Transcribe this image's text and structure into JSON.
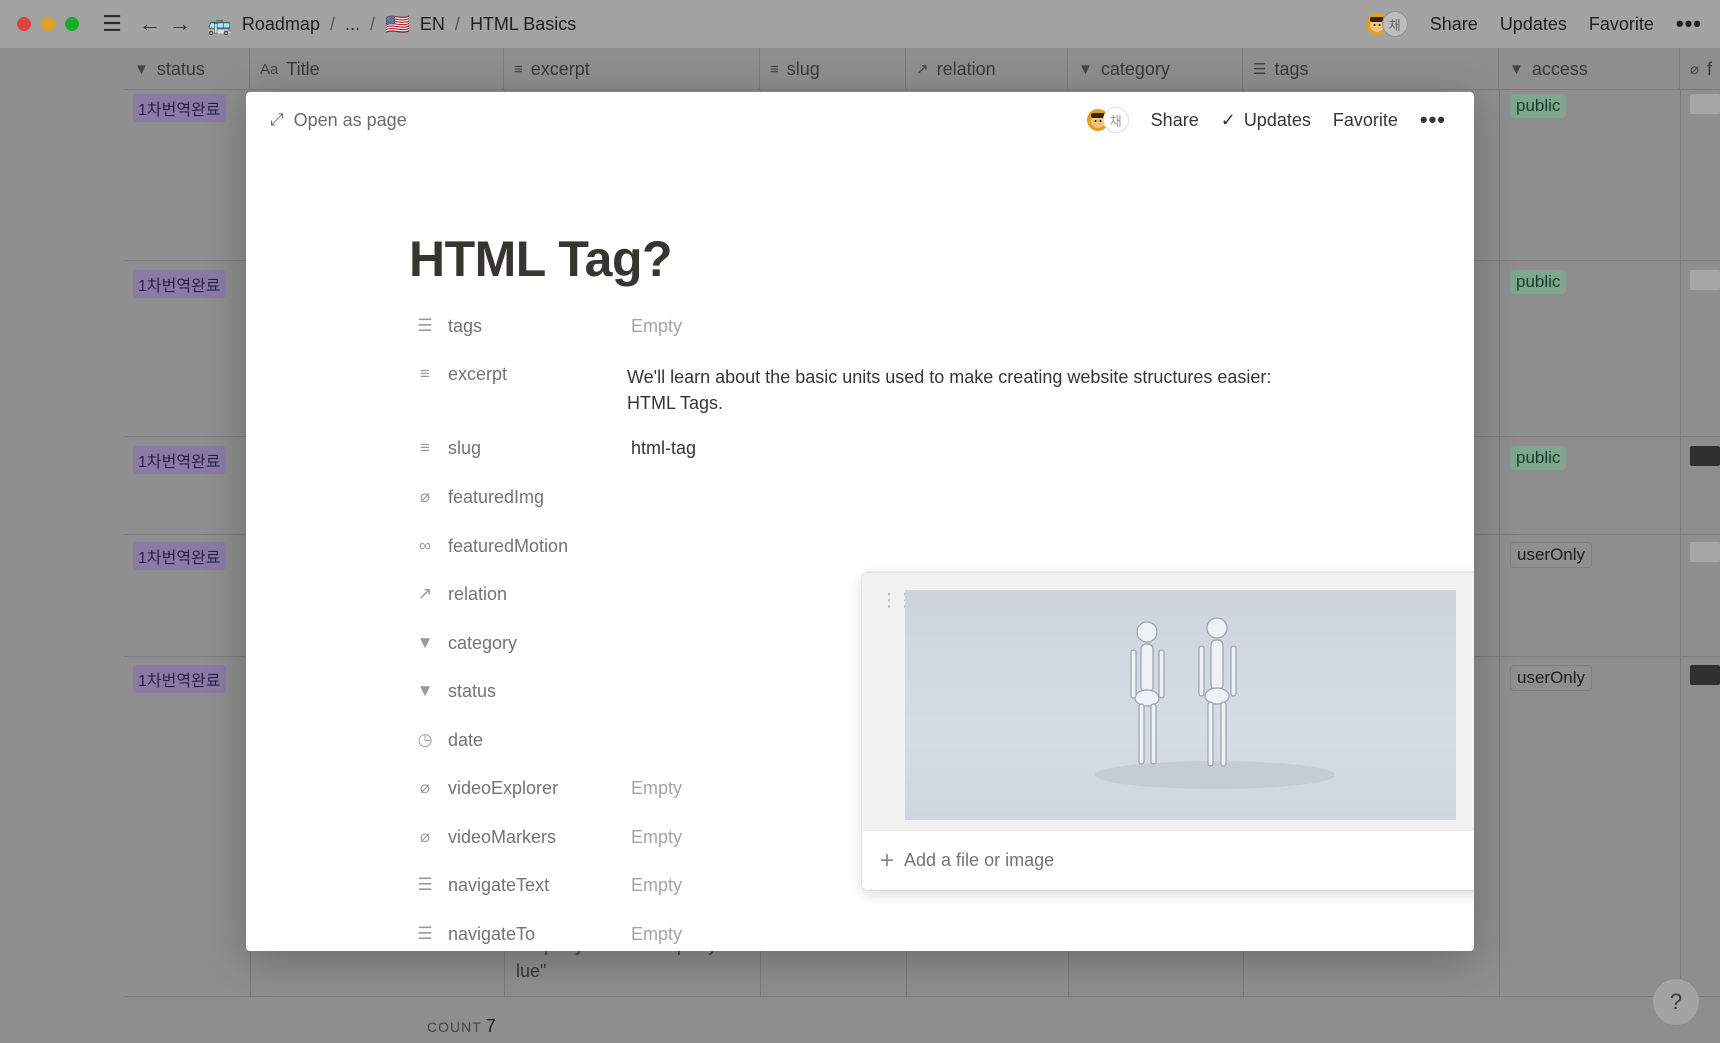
{
  "topbar": {
    "breadcrumbs": [
      {
        "icon": "bus-emoji",
        "emoji": "🚌",
        "label": "Roadmap"
      },
      {
        "label": "..."
      },
      {
        "icon": "us-flag-emoji",
        "emoji": "🇺🇸",
        "label": "EN"
      },
      {
        "label": "HTML Basics"
      }
    ],
    "separator": "/",
    "avatar_initial": "채",
    "share": "Share",
    "updates": "Updates",
    "favorite": "Favorite",
    "more": "•••"
  },
  "table": {
    "columns": [
      {
        "label": "status",
        "icon": "select-icon"
      },
      {
        "label": "Title",
        "icon": "text-icon",
        "glyph": "Aa"
      },
      {
        "label": "excerpt",
        "icon": "lines-icon"
      },
      {
        "label": "slug",
        "icon": "lines-icon"
      },
      {
        "label": "relation",
        "icon": "arrow-icon"
      },
      {
        "label": "category",
        "icon": "select-icon"
      },
      {
        "label": "tags",
        "icon": "list-icon"
      },
      {
        "label": "access",
        "icon": "select-icon"
      },
      {
        "label": "f",
        "icon": "paperclip-icon"
      }
    ],
    "rows": [
      {
        "status": "1차번역완료",
        "access": "public"
      },
      {
        "status": "1차번역완료",
        "access": "public"
      },
      {
        "status": "1차번역완료",
        "access": "public"
      },
      {
        "status": "1차번역완료",
        "access": "userOnly"
      },
      {
        "status": "1차번역완료",
        "access": "userOnly"
      }
    ],
    "partial_cell_text_1": "PropertyName=\"PropertyVa",
    "partial_cell_text_2": "lue\"",
    "count_label": "COUNT",
    "count_value": "7"
  },
  "modal": {
    "open_as_page": "Open as page",
    "avatar_initial": "채",
    "share": "Share",
    "updates": "Updates",
    "favorite": "Favorite",
    "more": "•••",
    "title": "HTML Tag?",
    "properties": [
      {
        "name": "tags",
        "icon": "list-icon",
        "value": "Empty",
        "empty": true
      },
      {
        "name": "excerpt",
        "icon": "lines-icon",
        "value": ""
      },
      {
        "name": "slug",
        "icon": "lines-icon",
        "value": "html-tag",
        "empty": false
      },
      {
        "name": "featuredImg",
        "icon": "paperclip-icon",
        "value": ""
      },
      {
        "name": "featuredMotion",
        "icon": "link-icon",
        "value": ""
      },
      {
        "name": "relation",
        "icon": "arrow-icon",
        "value": ""
      },
      {
        "name": "category",
        "icon": "select-icon",
        "value": ""
      },
      {
        "name": "status",
        "icon": "select-icon",
        "value": ""
      },
      {
        "name": "date",
        "icon": "clock-icon",
        "value": ""
      },
      {
        "name": "videoExplorer",
        "icon": "paperclip-icon",
        "value": "Empty",
        "empty": true
      },
      {
        "name": "videoMarkers",
        "icon": "paperclip-icon",
        "value": "Empty",
        "empty": true
      },
      {
        "name": "navigateText",
        "icon": "list-icon",
        "value": "Empty",
        "empty": true
      },
      {
        "name": "navigateTo",
        "icon": "list-icon",
        "value": "Empty",
        "empty": true
      }
    ],
    "excerpt_text": "We'll learn about the basic units used to make creating website structures easier: HTML Tags.",
    "file_popup": {
      "add_label": "Add a file or image",
      "more": "•••"
    }
  },
  "help": "?",
  "colors": {
    "status_tag_bg": "#8a7ba3",
    "public_tag_bg": "#7ea58d",
    "dim_overlay": "#8e8e8e"
  }
}
